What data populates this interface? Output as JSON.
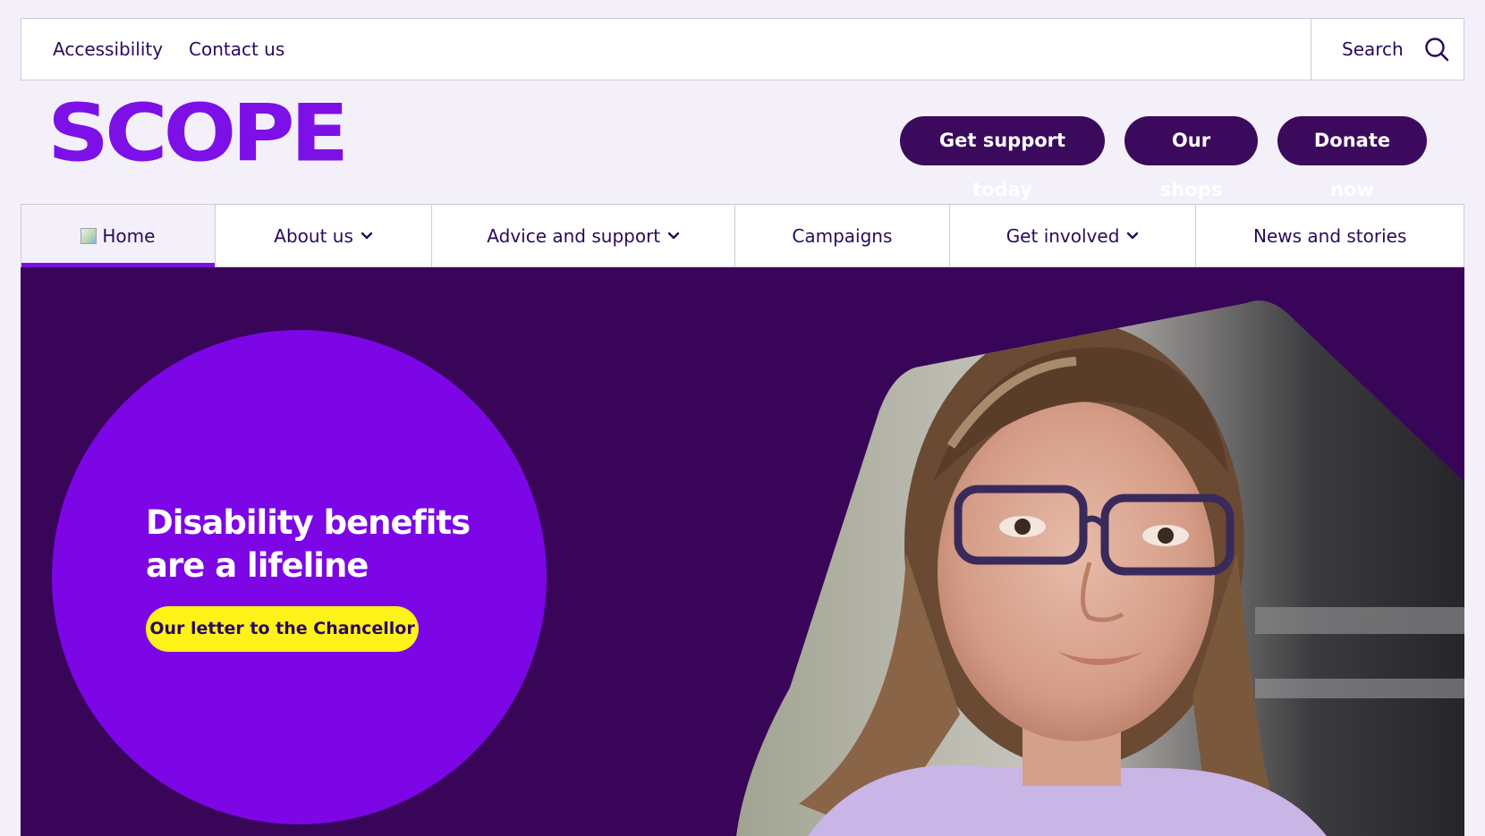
{
  "utility": {
    "accessibility": "Accessibility",
    "contact": "Contact us",
    "search_label": "Search",
    "search_icon": "search-icon"
  },
  "brand": {
    "logo_text": "SCOPE",
    "color": "#7c10e6"
  },
  "actions": {
    "support": "Get support today",
    "shops": "Our shops",
    "donate": "Donate now"
  },
  "nav": {
    "items": [
      {
        "label": "Home",
        "active": true
      },
      {
        "label": "About us",
        "dropdown": true
      },
      {
        "label": "Advice and support",
        "dropdown": true
      },
      {
        "label": "Campaigns"
      },
      {
        "label": "Get involved",
        "dropdown": true
      },
      {
        "label": "News and stories"
      }
    ]
  },
  "hero": {
    "title_line1": "Disability benefits",
    "title_line2": "are a lifeline",
    "cta": "Our letter to the Chancellor",
    "background": "#390558",
    "circle_color": "#7c06e6",
    "cta_color": "#fff218"
  }
}
